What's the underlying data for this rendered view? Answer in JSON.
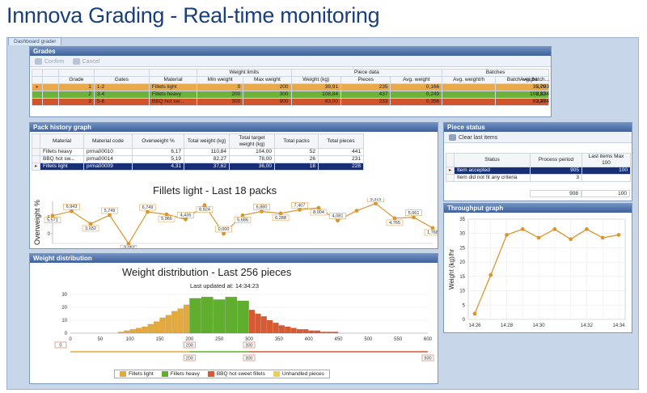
{
  "app_title": "Innnova Grading  - Real-time monitoring",
  "tab_label": "Dashboard grader",
  "grades": {
    "title": "Grades",
    "confirm_label": "Confirm",
    "cancel_label": "Cancel",
    "group_headers": [
      "Weight limits",
      "Piece data",
      "Batches"
    ],
    "columns": [
      "Grade",
      "Gates",
      "Material",
      "Min weight",
      "Max weight",
      "Weight (kg)",
      "Pieces",
      "Avg. weight",
      "Avg. weight/h",
      "Batch weight",
      "Avg. batch..."
    ],
    "rows": [
      {
        "grade": "1",
        "gates": "1-2",
        "material": "Fillets light",
        "min": "0",
        "max": "200",
        "weight": "39,91",
        "pieces": "235",
        "avg": "0,166",
        "avgh": "",
        "batch": "35,79",
        "avgbatch": "2,093"
      },
      {
        "grade": "2",
        "gates": "3-4",
        "material": "Fillets heavy",
        "min": "200",
        "max": "300",
        "weight": "108,84",
        "pieces": "437",
        "avg": "0,249",
        "avgh": "",
        "batch": "108,82",
        "avgbatch": "2,134"
      },
      {
        "grade": "3",
        "gates": "5-6",
        "material": "BBQ hot sw...",
        "min": "300",
        "max": "900",
        "weight": "83,00",
        "pieces": "233",
        "avg": "0,356",
        "avgh": "",
        "batch": "82,27",
        "avgbatch": "3,404"
      }
    ]
  },
  "pack_history": {
    "title": "Pack history graph",
    "columns": [
      "Material",
      "Material code",
      "Overweight %",
      "Total weight (kg)",
      "Total target weight (kg)",
      "Total packs",
      "Total pieces"
    ],
    "rows": [
      {
        "material": "Fillets heavy",
        "code": "prma00010",
        "over": "6,17",
        "total": "110,84",
        "target": "104,00",
        "packs": "52",
        "pieces": "441"
      },
      {
        "material": "BBQ hot sw...",
        "code": "prma00014",
        "over": "5,19",
        "total": "82,27",
        "target": "78,00",
        "packs": "26",
        "pieces": "231"
      },
      {
        "material": "Fillets light",
        "code": "prma00009",
        "over": "4,31",
        "total": "37,62",
        "target": "36,00",
        "packs": "18",
        "pieces": "228"
      }
    ]
  },
  "piece_status": {
    "title": "Piece status",
    "clear_label": "Clear last items",
    "columns": [
      "Status",
      "Process period",
      "Last items Max 100"
    ],
    "rows": [
      {
        "status": "Item accepted",
        "period": "905",
        "last": "100"
      },
      {
        "status": "Item did not fit any criteria",
        "period": "3",
        "last": ""
      }
    ],
    "totals": [
      "908",
      "100"
    ]
  },
  "throughput": {
    "title": "Throughput graph"
  },
  "weight_dist": {
    "title": "Weight distribution",
    "chart_title": "Weight distribution - Last 256 pieces",
    "updated": "Last updated at: 14:34:23",
    "range_labels": [
      "0",
      "200",
      "200",
      "300",
      "300",
      "900"
    ],
    "legend": [
      "Fillets light",
      "Fillets heavy",
      "BBQ hot sweet fillets",
      "Unhandled pieces"
    ]
  },
  "chart_data": [
    {
      "type": "line",
      "title": "Fillets light - Last 18 packs",
      "ylabel": "Overweight %",
      "ylim": [
        -3,
        10
      ],
      "values": [
        5.571,
        6.943,
        3.032,
        5.749,
        -3.057,
        6.749,
        5.966,
        4.436,
        8.824,
        0.0,
        5.686,
        6.88,
        6.288,
        7.407,
        8.004,
        4.081,
        7.1,
        9.315,
        4.765,
        5.061,
        1.768
      ],
      "value_labels": [
        "5,571",
        "6,943",
        "3,032",
        "5,749",
        "-3,057",
        "6,749",
        "5,966",
        "4,436",
        "8,824",
        "0,000",
        "5,686",
        "6,880",
        "6,288",
        "7,407",
        "8,004",
        "4,081",
        "",
        "9,315",
        "4,765",
        "5,061",
        "1,768"
      ],
      "colors": {
        "line": "#d9962c"
      }
    },
    {
      "type": "line",
      "title": "",
      "xlabel": "",
      "ylabel": "Weight (kg)/hr",
      "categories": [
        "14:26",
        "",
        "14:28",
        "",
        "14:30",
        "",
        "",
        "14:32",
        "",
        "14:34"
      ],
      "x_ticks": [
        "14:26",
        "14:28",
        "14:30",
        "14:32",
        "14:34"
      ],
      "values": [
        2,
        15.5,
        29.5,
        31.5,
        28.5,
        31.5,
        28,
        31.5,
        28.5,
        29.5
      ],
      "ylim": [
        0,
        35
      ],
      "yticks": [
        0,
        5,
        10,
        15,
        20,
        25,
        30,
        35
      ],
      "colors": {
        "line": "#d9962c"
      }
    },
    {
      "type": "bar",
      "title": "Weight distribution - Last 256 pieces",
      "xlabel": "",
      "ylabel": "",
      "xlim": [
        0,
        600
      ],
      "ylim": [
        0,
        30
      ],
      "x_ticks": [
        "0",
        "50",
        "100",
        "150",
        "200",
        "250",
        "300",
        "350",
        "400",
        "450",
        "500",
        "550",
        "600"
      ],
      "y_ticks": [
        "0",
        "10",
        "20",
        "30"
      ],
      "bins": [
        {
          "x": 85,
          "v": 1,
          "s": "Fillets light"
        },
        {
          "x": 95,
          "v": 2,
          "s": "Fillets light"
        },
        {
          "x": 105,
          "v": 3,
          "s": "Fillets light"
        },
        {
          "x": 115,
          "v": 4,
          "s": "Fillets light"
        },
        {
          "x": 125,
          "v": 5,
          "s": "Fillets light"
        },
        {
          "x": 135,
          "v": 7,
          "s": "Fillets light"
        },
        {
          "x": 145,
          "v": 9,
          "s": "Fillets light"
        },
        {
          "x": 155,
          "v": 12,
          "s": "Fillets light"
        },
        {
          "x": 165,
          "v": 14,
          "s": "Fillets light"
        },
        {
          "x": 175,
          "v": 17,
          "s": "Fillets light"
        },
        {
          "x": 185,
          "v": 19,
          "s": "Fillets light"
        },
        {
          "x": 195,
          "v": 22,
          "s": "Fillets light"
        },
        {
          "x": 210,
          "v": 27,
          "s": "Fillets heavy"
        },
        {
          "x": 230,
          "v": 28,
          "s": "Fillets heavy"
        },
        {
          "x": 250,
          "v": 26,
          "s": "Fillets heavy"
        },
        {
          "x": 270,
          "v": 28,
          "s": "Fillets heavy"
        },
        {
          "x": 290,
          "v": 25,
          "s": "Fillets heavy"
        },
        {
          "x": 305,
          "v": 18,
          "s": "BBQ hot sweet fillets"
        },
        {
          "x": 315,
          "v": 15,
          "s": "BBQ hot sweet fillets"
        },
        {
          "x": 325,
          "v": 13,
          "s": "BBQ hot sweet fillets"
        },
        {
          "x": 335,
          "v": 10,
          "s": "BBQ hot sweet fillets"
        },
        {
          "x": 345,
          "v": 8,
          "s": "BBQ hot sweet fillets"
        },
        {
          "x": 355,
          "v": 6,
          "s": "BBQ hot sweet fillets"
        },
        {
          "x": 365,
          "v": 5,
          "s": "BBQ hot sweet fillets"
        },
        {
          "x": 375,
          "v": 4,
          "s": "BBQ hot sweet fillets"
        },
        {
          "x": 385,
          "v": 3,
          "s": "BBQ hot sweet fillets"
        },
        {
          "x": 395,
          "v": 3,
          "s": "BBQ hot sweet fillets"
        },
        {
          "x": 405,
          "v": 2,
          "s": "BBQ hot sweet fillets"
        },
        {
          "x": 415,
          "v": 2,
          "s": "BBQ hot sweet fillets"
        },
        {
          "x": 425,
          "v": 1,
          "s": "BBQ hot sweet fillets"
        },
        {
          "x": 435,
          "v": 1,
          "s": "BBQ hot sweet fillets"
        },
        {
          "x": 445,
          "v": 1,
          "s": "BBQ hot sweet fillets"
        }
      ],
      "colors": {
        "Fillets light": "#e3a93d",
        "Fillets heavy": "#5fae2e",
        "BBQ hot sweet fillets": "#d65a32",
        "Unhandled pieces": "#e8cf5a"
      }
    }
  ]
}
